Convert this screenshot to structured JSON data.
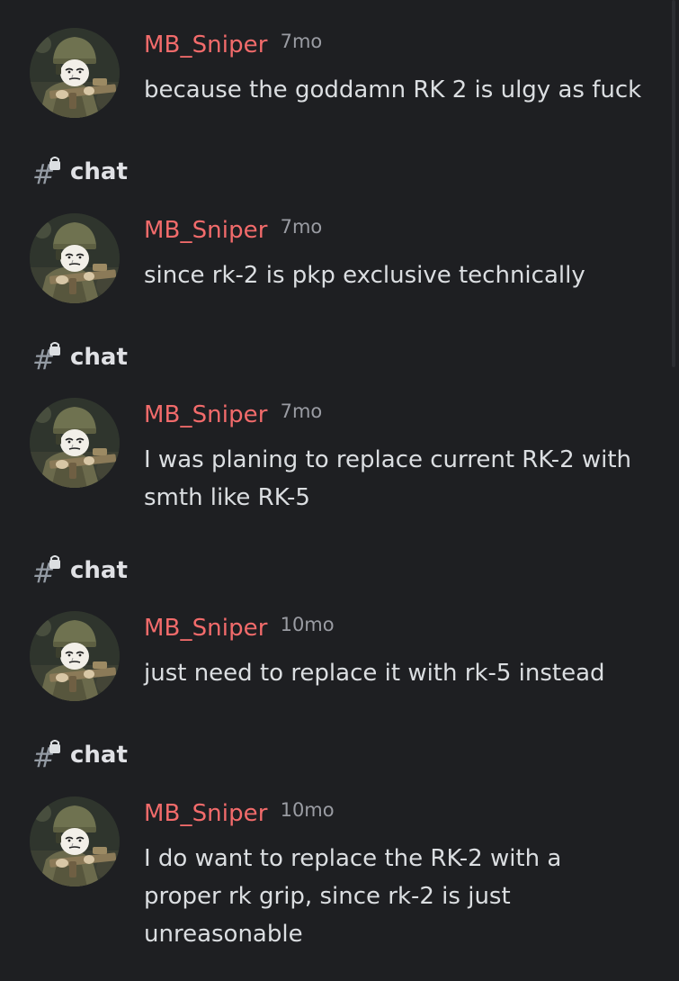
{
  "colors": {
    "background": "#1e1f22",
    "username": "#f26b6b",
    "timestamp": "#9a9ca3",
    "text": "#dbdee1",
    "channel": "#e0e1e5"
  },
  "results": [
    {
      "author": "MB_Sniper",
      "time": "7mo",
      "text": "because the goddamn RK 2 is ulgy as fuck",
      "channel": "chat"
    },
    {
      "author": "MB_Sniper",
      "time": "7mo",
      "text": "since rk-2 is pkp exclusive technically",
      "channel": "chat"
    },
    {
      "author": "MB_Sniper",
      "time": "7mo",
      "text": "I was planing to replace current RK-2 with smth like RK-5",
      "channel": "chat"
    },
    {
      "author": "MB_Sniper",
      "time": "10mo",
      "text": "just need to replace it with rk-5 instead",
      "channel": "chat"
    },
    {
      "author": "MB_Sniper",
      "time": "10mo",
      "text": "I do want to replace the RK-2 with a proper rk grip, since rk-2 is just unreasonable"
    }
  ],
  "icons": {
    "avatar": "soldier-avatar-icon",
    "channel": "locked-text-channel-icon"
  }
}
